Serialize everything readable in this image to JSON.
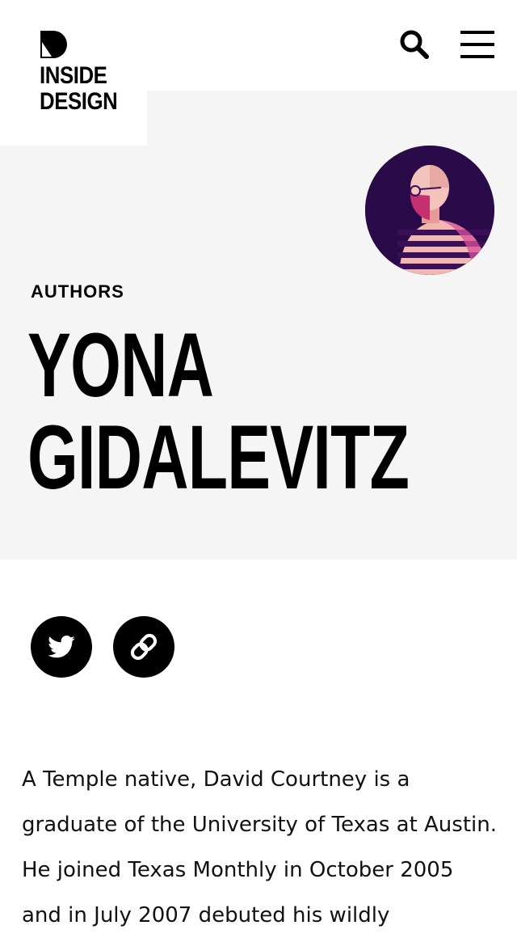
{
  "brand": {
    "logo_text": "INSIDE\nDESIGN",
    "icon": "inside-design-logo-icon"
  },
  "header": {
    "search_icon": "search-icon",
    "menu_icon": "hamburger-menu-icon"
  },
  "author": {
    "section_label": "AUTHORS",
    "name_line1": "YONA",
    "name_line2": "GIDALEVITZ",
    "avatar": "author-avatar-illustration"
  },
  "social": {
    "twitter_icon": "twitter-icon",
    "link_icon": "link-icon"
  },
  "bio": {
    "text": "A Temple native, David Courtney is a graduate of the University of Texas at Austin. He joined Texas Monthly in October 2005 and in July 2007 debuted his wildly"
  },
  "colors": {
    "hero_bg": "#f5f5f5",
    "avatar_bg": "#2b0a4a",
    "text": "#000000"
  }
}
